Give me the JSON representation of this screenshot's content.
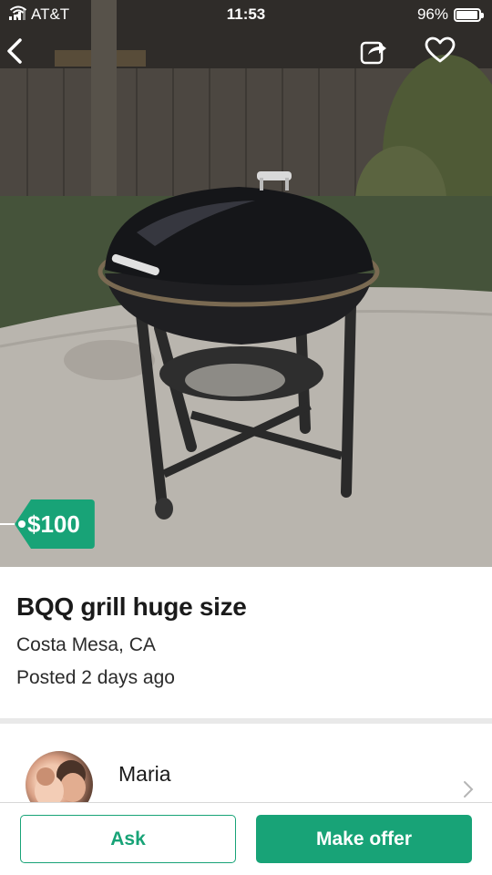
{
  "status_bar": {
    "carrier": "AT&T",
    "time": "11:53",
    "battery": "96%",
    "battery_level": 0.96
  },
  "nav": {
    "back_icon": "chevron-left-icon",
    "share_icon": "share-icon",
    "favorite_icon": "heart-icon"
  },
  "listing": {
    "price": "$100",
    "title": "BQQ grill huge size",
    "location": "Costa Mesa, CA",
    "posted": "Posted 2 days ago"
  },
  "seller": {
    "name": "Maria",
    "chevron_icon": "chevron-right-icon"
  },
  "actions": {
    "ask_label": "Ask",
    "offer_label": "Make offer"
  },
  "colors": {
    "accent": "#18a377"
  }
}
